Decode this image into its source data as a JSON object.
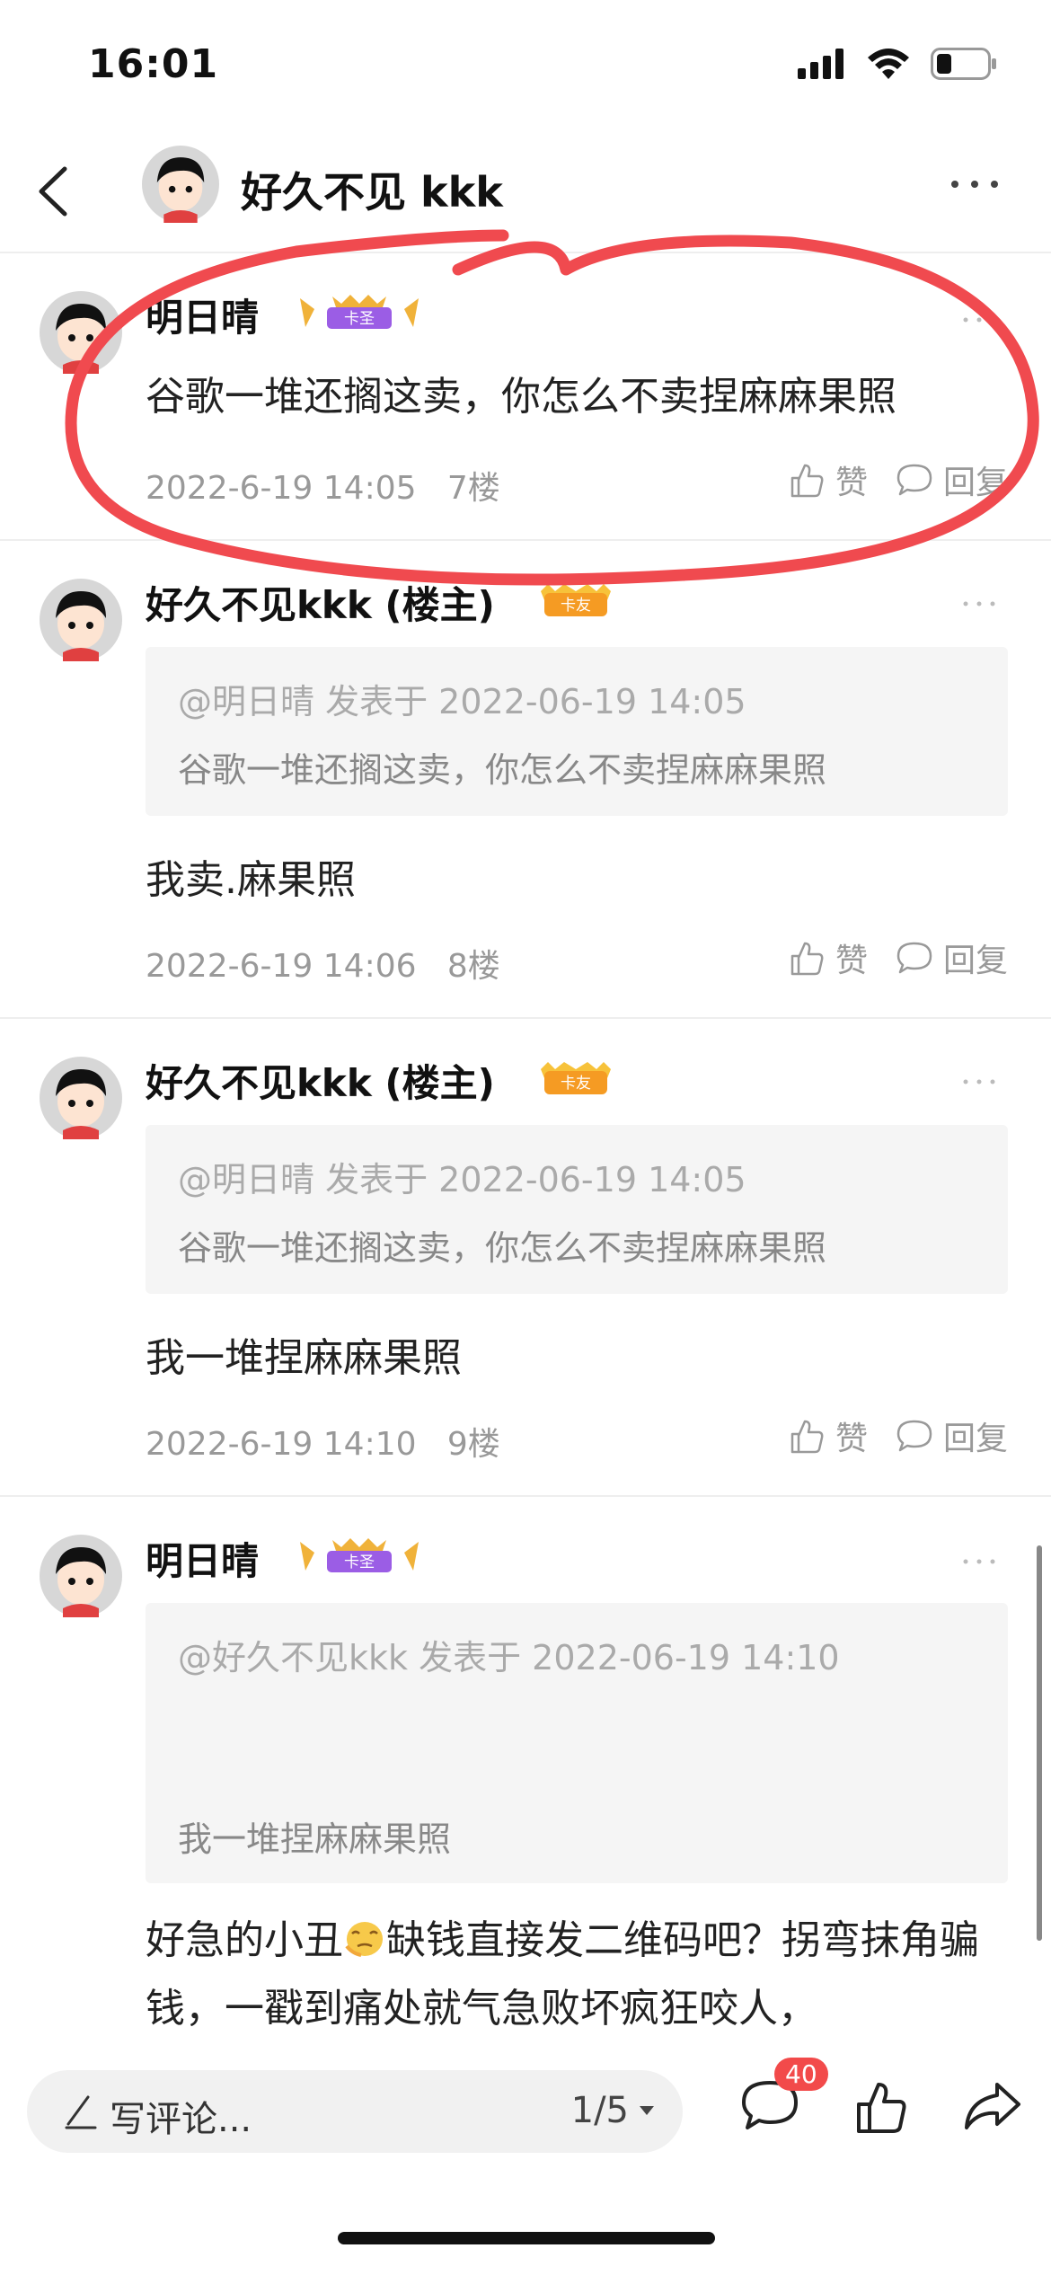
{
  "status": {
    "time": "16:01"
  },
  "nav": {
    "title": "好久不见 kkk"
  },
  "comments": [
    {
      "username": "明日晴",
      "badge": "卡圣",
      "text": "谷歌一堆还搁这卖，你怎么不卖捏麻麻果照",
      "date": "2022-6-19 14:05",
      "floor": "7楼",
      "like_label": "赞",
      "reply_label": "回复"
    },
    {
      "username": "好久不见kkk (楼主)",
      "badge": "卡友",
      "quote_header": "@明日晴 发表于 2022-06-19 14:05",
      "quote_text": "谷歌一堆还搁这卖，你怎么不卖捏麻麻果照",
      "text": "我卖.麻果照",
      "date": "2022-6-19 14:06",
      "floor": "8楼",
      "like_label": "赞",
      "reply_label": "回复"
    },
    {
      "username": "好久不见kkk (楼主)",
      "badge": "卡友",
      "quote_header": "@明日晴 发表于 2022-06-19 14:05",
      "quote_text": "谷歌一堆还搁这卖，你怎么不卖捏麻麻果照",
      "text": "我一堆捏麻麻果照",
      "date": "2022-6-19 14:10",
      "floor": "9楼",
      "like_label": "赞",
      "reply_label": "回复"
    },
    {
      "username": "明日晴",
      "badge": "卡圣",
      "quote_header": "@好久不见kkk 发表于 2022-06-19 14:10",
      "quote_text": "我一堆捏麻麻果照",
      "text_part1": "好急的小丑",
      "text_part2": "缺钱直接发二维码吧？拐弯抹角骗钱，一戳到痛处就气急败坏疯狂咬人，"
    }
  ],
  "bottom": {
    "placeholder": "写评论...",
    "page": "1/5",
    "comment_count": "40"
  },
  "colors": {
    "annotation": "#f04a4f",
    "badge_purple": "#9b5de5",
    "badge_orange": "#f59b23"
  }
}
